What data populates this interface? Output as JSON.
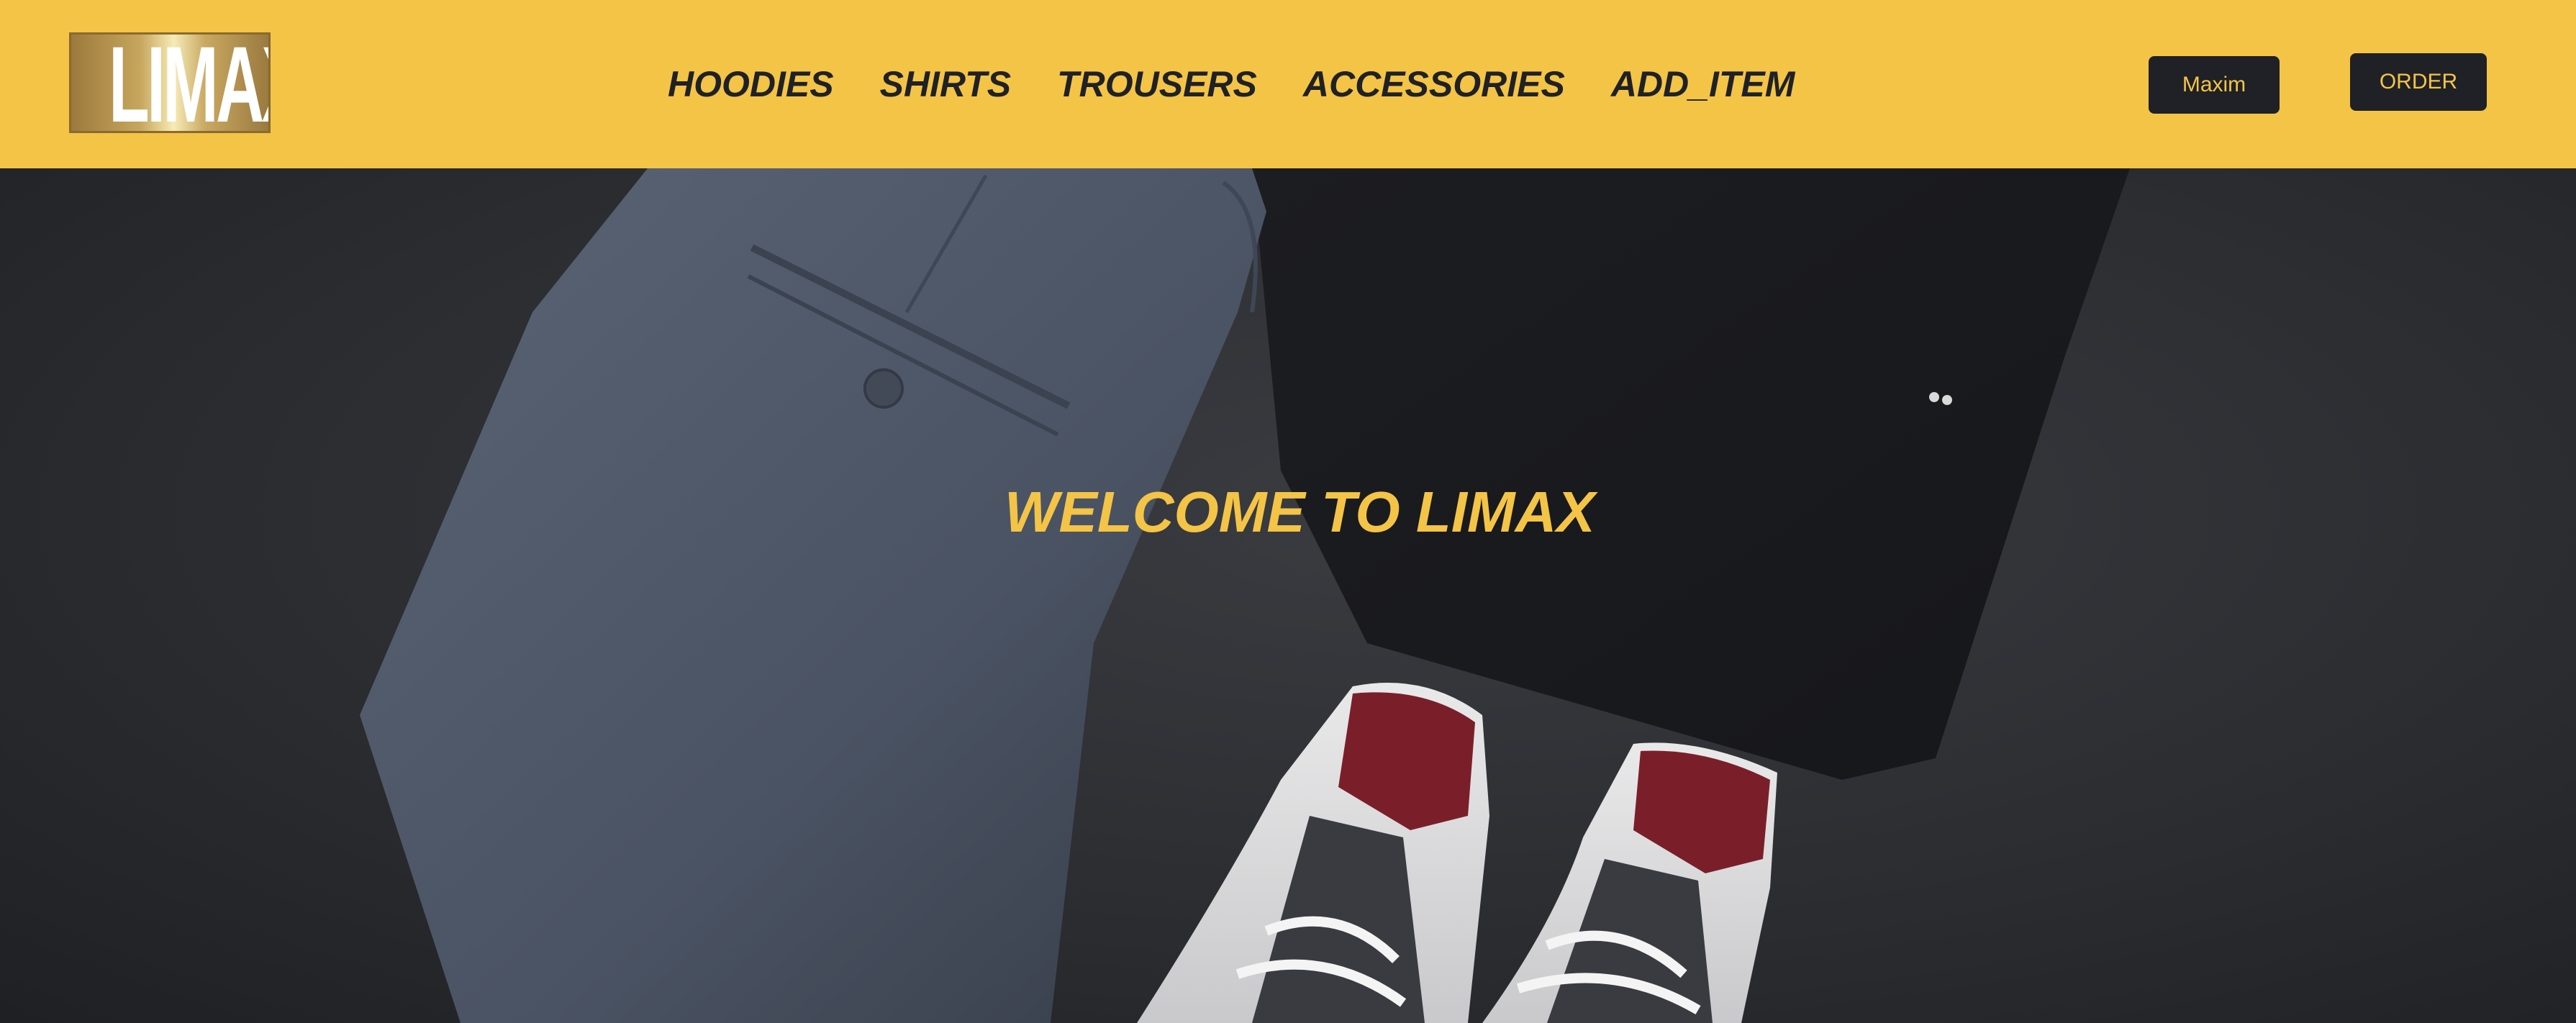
{
  "header": {
    "logo_text": "LIMAX",
    "nav": [
      {
        "label": "HOODIES"
      },
      {
        "label": "SHIRTS"
      },
      {
        "label": "TROUSERS"
      },
      {
        "label": "ACCESSORIES"
      },
      {
        "label": "ADD_ITEM"
      }
    ],
    "user_button": "Maxim",
    "order_button": "ORDER"
  },
  "hero": {
    "title": "WELCOME TO LIMAX"
  },
  "colors": {
    "accent": "#f4c447",
    "dark": "#1f2126"
  }
}
